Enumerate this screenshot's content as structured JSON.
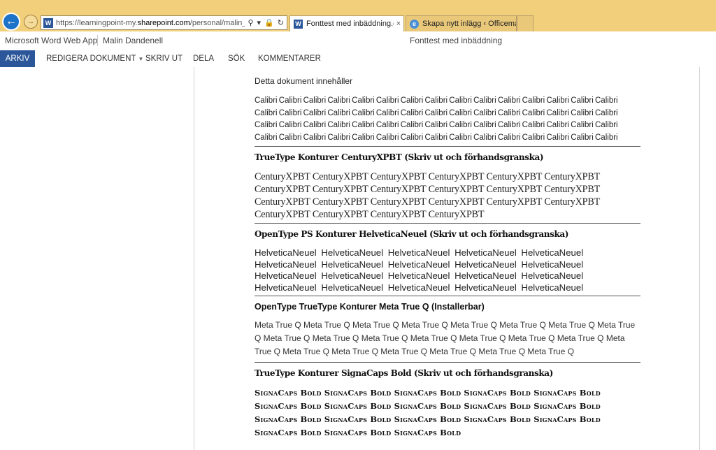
{
  "browser": {
    "address_prefix": "https://learningpoint-my.",
    "address_domain": "sharepoint.com",
    "address_suffix": "/personal/malin_learnir",
    "tabs": [
      {
        "label": "Fonttest med inbäddning.d...",
        "close": "×"
      },
      {
        "label": "Skapa nytt inlägg ‹ Officemast..."
      }
    ]
  },
  "app": {
    "name": "Microsoft Word Web App",
    "user": "Malin Dandenell",
    "document_title": "Fonttest med inbäddning"
  },
  "ribbon": {
    "file_tab": "ARKIV",
    "tabs": [
      "REDIGERA DOKUMENT",
      "SKRIV UT",
      "DELA",
      "SÖK",
      "KOMMENTARER"
    ]
  },
  "document": {
    "intro": "Detta dokument innehåller",
    "calibri_text": "Calibri Calibri Calibri Calibri Calibri Calibri Calibri Calibri Calibri Calibri Calibri Calibri Calibri Calibri Calibri Calibri Calibri Calibri Calibri Calibri Calibri Calibri Calibri Calibri Calibri Calibri Calibri Calibri Calibri Calibri Calibri Calibri Calibri Calibri Calibri Calibri Calibri Calibri Calibri Calibri Calibri Calibri Calibri Calibri Calibri Calibri Calibri Calibri Calibri Calibri Calibri Calibri Calibri Calibri Calibri Calibri Calibri Calibri Calibri Calibri",
    "century_heading": "TrueType Konturer CenturyXPBT (Skriv ut och förhandsgranska)",
    "century_text": "CenturyXPBT CenturyXPBT CenturyXPBT CenturyXPBT CenturyXPBT CenturyXPBT CenturyXPBT CenturyXPBT CenturyXPBT CenturyXPBT CenturyXPBT CenturyXPBT CenturyXPBT CenturyXPBT CenturyXPBT CenturyXPBT CenturyXPBT CenturyXPBT CenturyXPBT CenturyXPBT CenturyXPBT CenturyXPBT",
    "helvetica_heading": "OpenType PS Konturer HelveticaNeuel (Skriv ut och förhandsgranska)",
    "helvetica_text": "HelveticaNeuel HelveticaNeuel HelveticaNeuel HelveticaNeuel HelveticaNeuel HelveticaNeuel HelveticaNeuel HelveticaNeuel HelveticaNeuel HelveticaNeuel HelveticaNeuel HelveticaNeuel HelveticaNeuel HelveticaNeuel HelveticaNeuel HelveticaNeuel HelveticaNeuel HelveticaNeuel HelveticaNeuel HelveticaNeuel",
    "meta_heading": "OpenType TrueType Konturer Meta True Q (Installerbar)",
    "meta_text": "Meta True Q Meta True Q Meta True Q Meta True Q Meta True Q Meta True Q Meta True Q Meta True Q Meta True Q Meta True Q Meta True Q Meta True Q Meta True Q Meta True Q Meta True Q Meta True Q Meta True Q Meta True Q Meta True Q Meta True Q Meta True Q Meta True Q",
    "signa_heading": "TrueType Konturer SignaCaps Bold (Skriv ut och förhandsgranska)",
    "signa_text": "SignaCaps Bold SignaCaps Bold SignaCaps Bold SignaCaps Bold SignaCaps Bold SignaCaps Bold SignaCaps Bold SignaCaps Bold SignaCaps Bold SignaCaps Bold SignaCaps Bold SignaCaps Bold SignaCaps Bold SignaCaps Bold SignaCaps Bold SignaCaps Bold SignaCaps Bold SignaCaps Bold"
  },
  "icons": {
    "back": "back-arrow-icon",
    "forward": "forward-arrow-icon",
    "search": "search-icon",
    "lock": "lock-icon",
    "refresh": "refresh-icon",
    "word": "word-icon",
    "ie": "ie-icon"
  },
  "colors": {
    "chrome": "#f2cf7b",
    "word_blue": "#2b579a",
    "back_button": "#1e73c8"
  }
}
